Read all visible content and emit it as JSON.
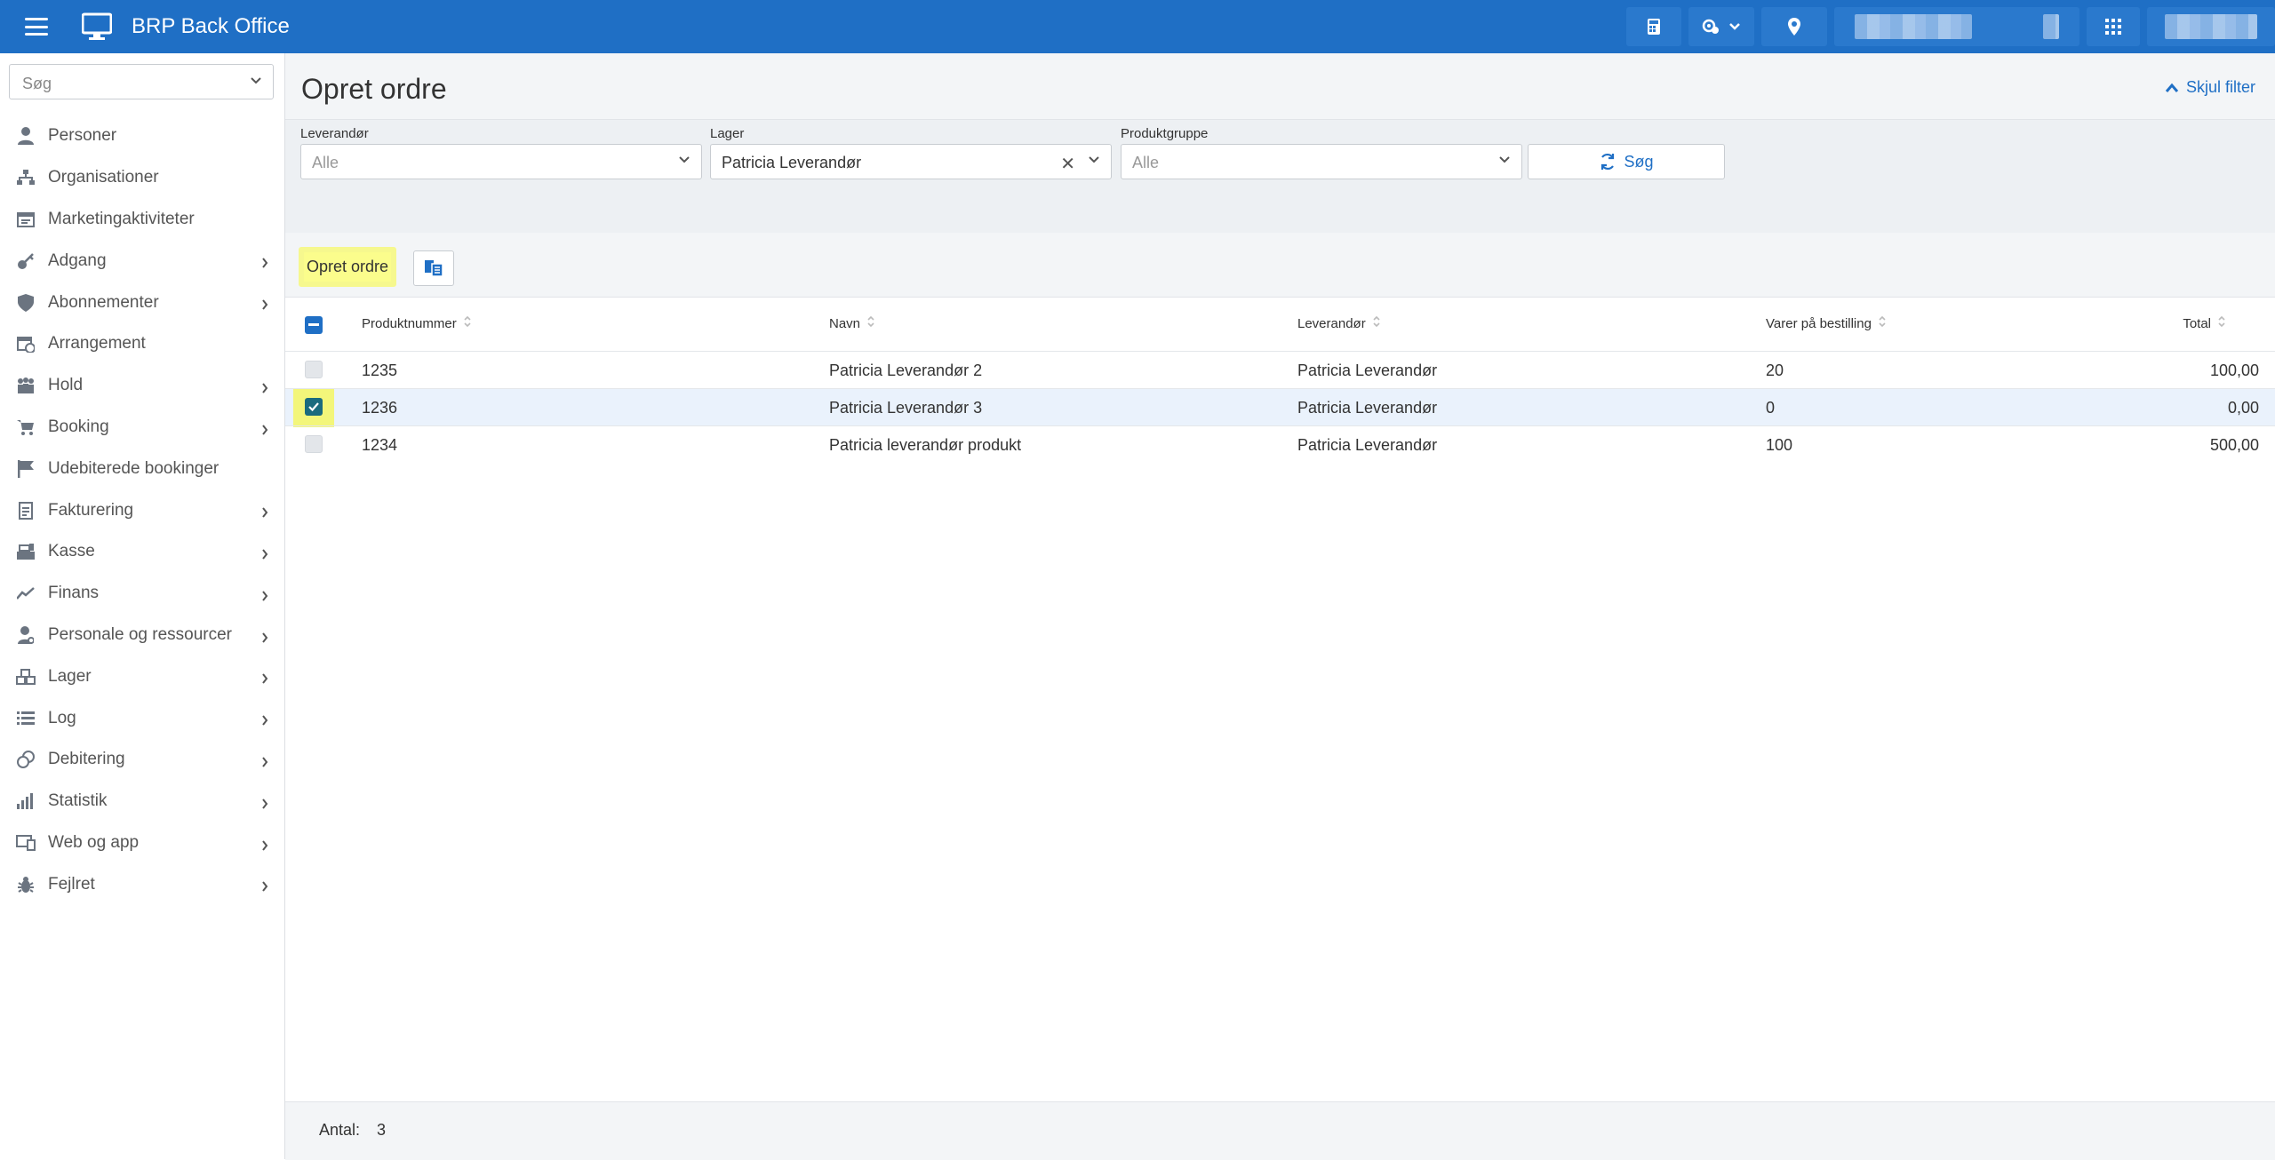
{
  "app": {
    "title": "BRP Back Office"
  },
  "sidebar": {
    "search_placeholder": "Søg",
    "items": [
      {
        "label": "Personer",
        "icon": "person-icon",
        "has_arrow": false
      },
      {
        "label": "Organisationer",
        "icon": "org-chart-icon",
        "has_arrow": false
      },
      {
        "label": "Marketingaktiviteter",
        "icon": "calendar-list-icon",
        "has_arrow": false
      },
      {
        "label": "Adgang",
        "icon": "key-icon",
        "has_arrow": true
      },
      {
        "label": "Abonnementer",
        "icon": "shield-icon",
        "has_arrow": true
      },
      {
        "label": "Arrangement",
        "icon": "calendar-clock-icon",
        "has_arrow": false
      },
      {
        "label": "Hold",
        "icon": "group-icon",
        "has_arrow": true
      },
      {
        "label": "Booking",
        "icon": "cart-icon",
        "has_arrow": true
      },
      {
        "label": "Udebiterede bookinger",
        "icon": "flag-icon",
        "has_arrow": false
      },
      {
        "label": "Fakturering",
        "icon": "invoice-icon",
        "has_arrow": true
      },
      {
        "label": "Kasse",
        "icon": "cash-register-icon",
        "has_arrow": true
      },
      {
        "label": "Finans",
        "icon": "trend-line-icon",
        "has_arrow": true
      },
      {
        "label": "Personale og ressourcer",
        "icon": "staff-icon",
        "has_arrow": true
      },
      {
        "label": "Lager",
        "icon": "boxes-icon",
        "has_arrow": true
      },
      {
        "label": "Log",
        "icon": "list-icon",
        "has_arrow": true
      },
      {
        "label": "Debitering",
        "icon": "coins-icon",
        "has_arrow": true
      },
      {
        "label": "Statistik",
        "icon": "bar-chart-icon",
        "has_arrow": true
      },
      {
        "label": "Web og app",
        "icon": "web-app-icon",
        "has_arrow": true
      },
      {
        "label": "Fejlret",
        "icon": "bug-icon",
        "has_arrow": true
      }
    ]
  },
  "page": {
    "title": "Opret ordre",
    "hide_filter": "Skjul filter"
  },
  "filters": {
    "leverandor": {
      "label": "Leverandør",
      "placeholder": "Alle"
    },
    "lager": {
      "label": "Lager",
      "value": "Patricia Leverandør"
    },
    "produktgruppe": {
      "label": "Produktgruppe",
      "placeholder": "Alle"
    },
    "search_button": "Søg"
  },
  "actions": {
    "create_order": "Opret ordre"
  },
  "table": {
    "columns": [
      "Produktnummer",
      "Navn",
      "Leverandør",
      "Varer på bestilling",
      "Total"
    ],
    "rows": [
      {
        "produktnummer": "1235",
        "navn": "Patricia Leverandør 2",
        "leverandor": "Patricia Leverandør",
        "varer": "20",
        "total": "100,00",
        "checked": false
      },
      {
        "produktnummer": "1236",
        "navn": "Patricia Leverandør 3",
        "leverandor": "Patricia Leverandør",
        "varer": "0",
        "total": "0,00",
        "checked": true
      },
      {
        "produktnummer": "1234",
        "navn": "Patricia leverandør produkt",
        "leverandor": "Patricia Leverandør",
        "varer": "100",
        "total": "500,00",
        "checked": false
      }
    ]
  },
  "footer": {
    "count_label": "Antal:",
    "count_value": "3"
  },
  "colors": {
    "topbar": "#1f6fc5",
    "accent": "#1f6fc5",
    "highlight": "#f4f66f",
    "checkbox_checked": "#1a6b7e"
  }
}
